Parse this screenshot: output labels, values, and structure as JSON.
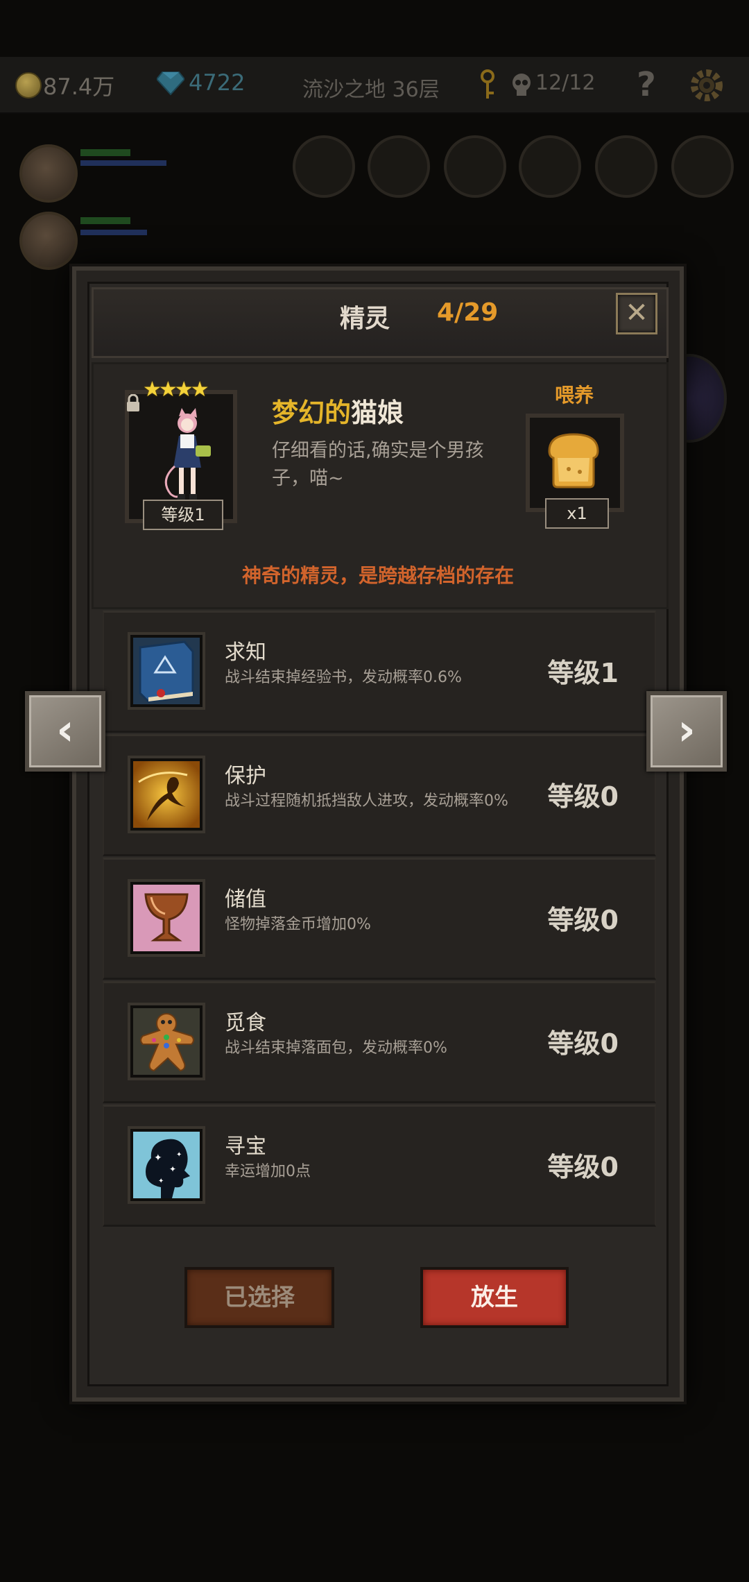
{
  "top_bar": {
    "gold": "87.4万",
    "gems": "4722",
    "location": "流沙之地 36层",
    "kills": "12/12",
    "help": "?"
  },
  "dialog": {
    "title": "精灵",
    "count": "4/29",
    "close": "✕",
    "pet": {
      "stars": "★★★★",
      "name_highlight": "梦幻的",
      "name_rest": "猫娘",
      "description": "仔细看的话,确实是个男孩子，喵~",
      "level": "等级1",
      "feed_label": "喂养",
      "feed_quantity": "x1",
      "note": "神奇的精灵，是跨越存档的存在"
    },
    "skills": [
      {
        "name": "求知",
        "description": "战斗结束掉经验书，发动概率0.6%",
        "level": "等级1",
        "icon": "book-icon"
      },
      {
        "name": "保护",
        "description": "战斗过程随机抵挡敌人进攻，发动概率0%",
        "level": "等级0",
        "icon": "shield-figure-icon"
      },
      {
        "name": "储值",
        "description": "怪物掉落金币增加0%",
        "level": "等级0",
        "icon": "goblet-icon"
      },
      {
        "name": "觅食",
        "description": "战斗结束掉落面包，发动概率0%",
        "level": "等级0",
        "icon": "gingerbread-icon"
      },
      {
        "name": "寻宝",
        "description": "幸运增加0点",
        "level": "等级0",
        "icon": "sparkle-silhouette-icon"
      }
    ],
    "buttons": {
      "selected": "已选择",
      "release": "放生"
    }
  },
  "nav": {
    "prev": "‹",
    "next": "›"
  },
  "colors": {
    "accent_orange": "#e59a2a",
    "note_red": "#d2642c",
    "release_red": "#b6362a"
  }
}
